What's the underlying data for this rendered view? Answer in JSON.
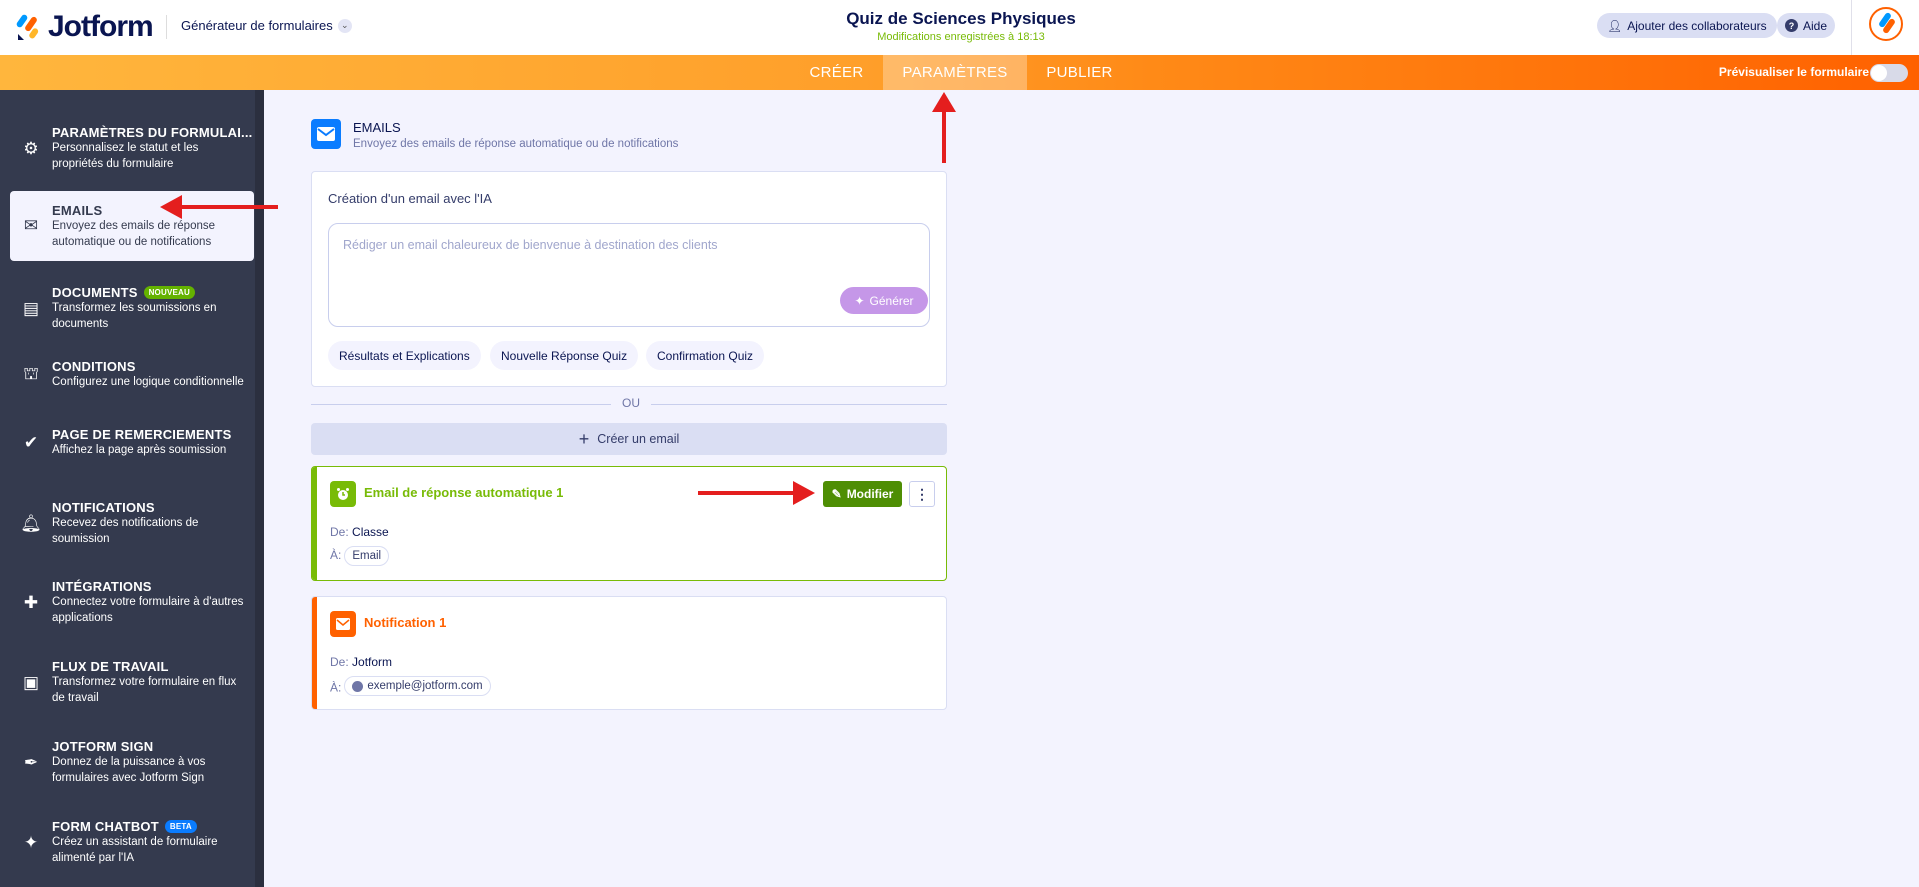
{
  "header": {
    "brand": "Jotform",
    "builder": "Générateur de formulaires",
    "form_title": "Quiz de Sciences Physiques",
    "save_status": "Modifications enregistrées à 18:13",
    "collaborators": "Ajouter des collaborateurs",
    "help": "Aide"
  },
  "nav": {
    "tabs": [
      {
        "label": "CRÉER"
      },
      {
        "label": "PARAMÈTRES",
        "active": true
      },
      {
        "label": "PUBLIER"
      }
    ],
    "preview": "Prévisualiser le formulaire",
    "preview_on": false
  },
  "sidebar": {
    "items": [
      {
        "title": "PARAMÈTRES DU FORMULAI...",
        "desc": "Personnalisez le statut et les propriétés du formulaire",
        "icon": "gear-icon"
      },
      {
        "title": "EMAILS",
        "desc": "Envoyez des emails de réponse automatique ou de notifications",
        "icon": "envelope-icon",
        "active": true
      },
      {
        "title": "DOCUMENTS",
        "badge": "NOUVEAU",
        "desc": "Transformez les soumissions en documents",
        "icon": "document-icon"
      },
      {
        "title": "CONDITIONS",
        "desc": "Configurez une logique conditionnelle",
        "icon": "hierarchy-icon"
      },
      {
        "title": "PAGE DE REMERCIEMENTS",
        "desc": "Affichez la page après soumission",
        "icon": "check-circle-icon"
      },
      {
        "title": "NOTIFICATIONS",
        "desc": "Recevez des notifications de soumission",
        "icon": "bell-icon"
      },
      {
        "title": "INTÉGRATIONS",
        "desc": "Connectez votre formulaire à d'autres applications",
        "icon": "puzzle-icon"
      },
      {
        "title": "FLUX DE TRAVAIL",
        "desc": "Transformez votre formulaire en flux de travail",
        "icon": "workflow-icon"
      },
      {
        "title": "JOTFORM SIGN",
        "desc": "Donnez de la puissance à vos formulaires avec Jotform Sign",
        "icon": "pen-nib-icon"
      },
      {
        "title": "FORM CHATBOT",
        "badge": "BETA",
        "desc": "Créez un assistant de formulaire alimenté par l'IA",
        "icon": "sparkle-icon"
      }
    ]
  },
  "main": {
    "section_title": "EMAILS",
    "section_desc": "Envoyez des emails de réponse automatique ou de notifications",
    "ai": {
      "title": "Création d'un email avec l'IA",
      "placeholder": "Rédiger un email chaleureux de bienvenue à destination des clients",
      "generate": "Générer",
      "suggestions": [
        "Résultats et Explications",
        "Nouvelle Réponse Quiz",
        "Confirmation Quiz"
      ]
    },
    "or": "OU",
    "create": "Créer un email",
    "emails": [
      {
        "name": "Email de réponse automatique 1",
        "from_label": "De:",
        "from": "Classe",
        "to_label": "À:",
        "to": "Email",
        "edit": "Modifier",
        "color": "#78bb07"
      },
      {
        "name": "Notification 1",
        "from_label": "De:",
        "from": "Jotform",
        "to_label": "À:",
        "to": "exemple@jotform.com",
        "color": "#ff6100"
      }
    ]
  }
}
